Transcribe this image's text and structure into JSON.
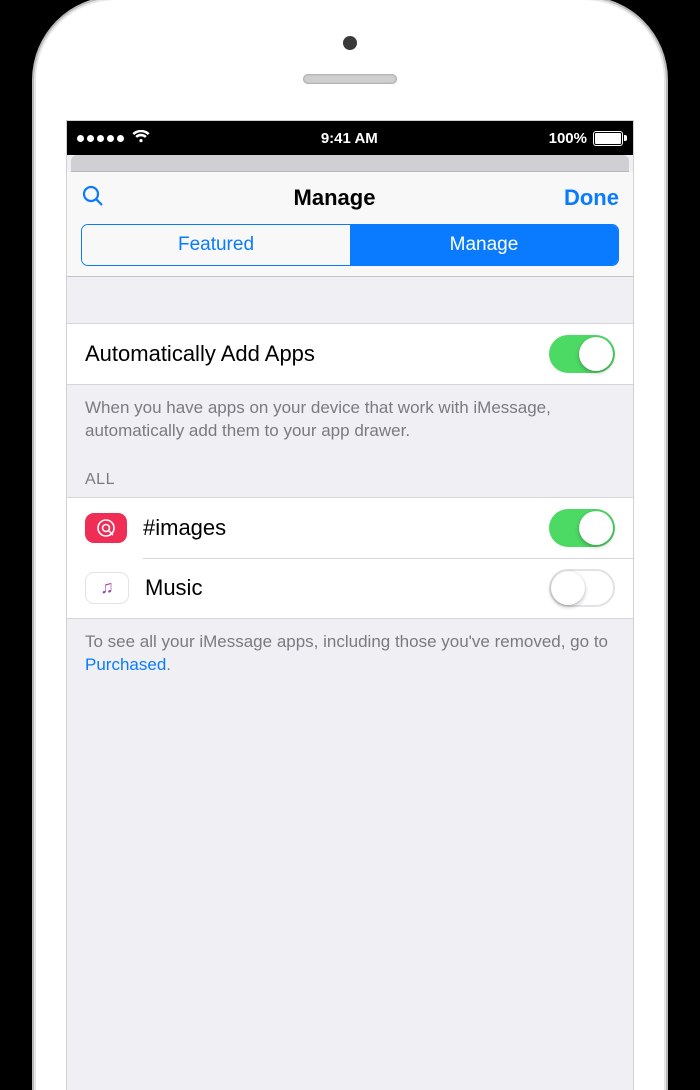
{
  "statusbar": {
    "time": "9:41 AM",
    "battery_pct": "100%"
  },
  "nav": {
    "title": "Manage",
    "done_label": "Done",
    "segments": {
      "featured": "Featured",
      "manage": "Manage"
    }
  },
  "auto_add": {
    "label": "Automatically Add Apps",
    "enabled": true,
    "footer": "When you have apps on your device that work with iMessage, automatically add them to your app drawer."
  },
  "all_section": {
    "header": "ALL",
    "apps": [
      {
        "name": "#images",
        "icon": "images-icon",
        "enabled": true
      },
      {
        "name": "Music",
        "icon": "music-icon",
        "enabled": false
      }
    ],
    "footer_pre": "To see all your iMessage apps, including those you've removed, go to ",
    "footer_link": "Purchased",
    "footer_post": "."
  }
}
